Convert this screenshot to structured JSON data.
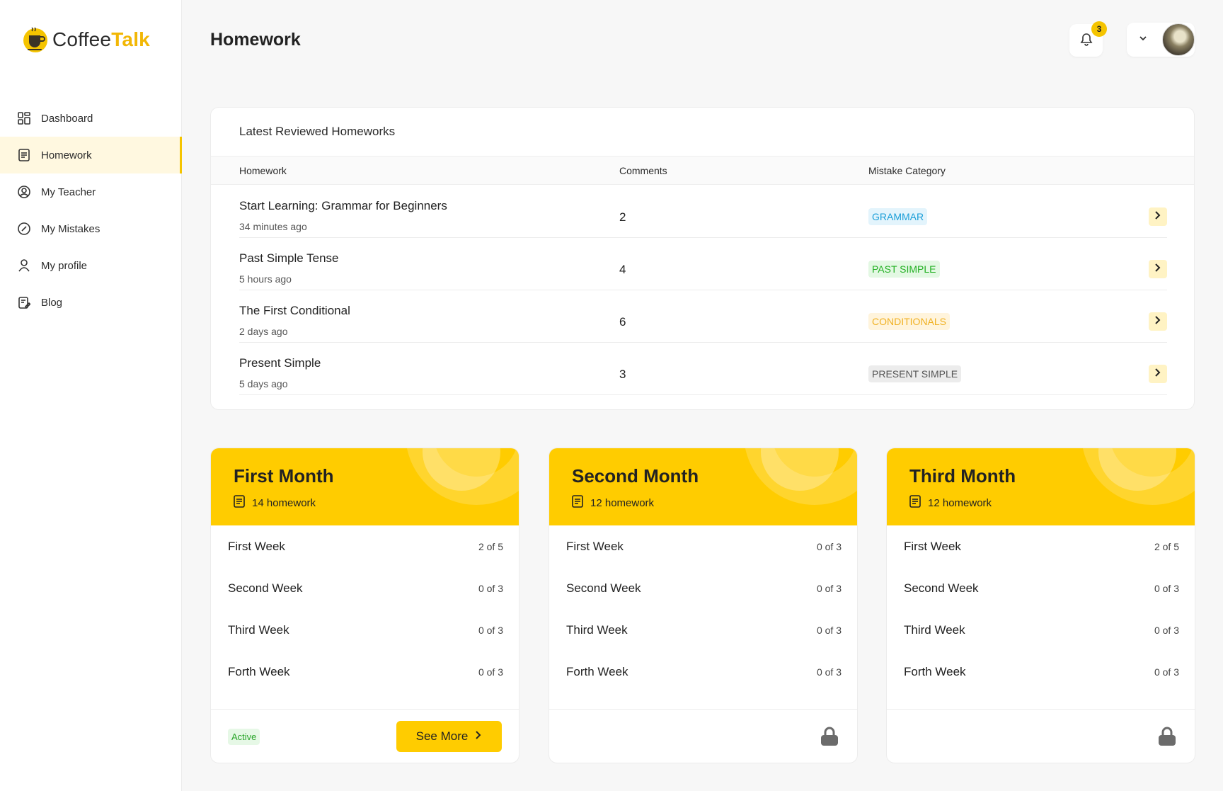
{
  "app": {
    "logo_first": "Coffee",
    "logo_second": "Talk"
  },
  "sidebar": {
    "items": [
      {
        "label": "Dashboard",
        "icon": "dashboard-icon"
      },
      {
        "label": "Homework",
        "icon": "homework-icon",
        "active": true
      },
      {
        "label": "My Teacher",
        "icon": "teacher-icon"
      },
      {
        "label": "My Mistakes",
        "icon": "mistakes-icon"
      },
      {
        "label": "My profile",
        "icon": "profile-icon"
      },
      {
        "label": "Blog",
        "icon": "blog-icon"
      }
    ]
  },
  "header": {
    "title": "Homework",
    "notification_count": "3"
  },
  "reviewed": {
    "title": "Latest Reviewed Homeworks",
    "columns": {
      "homework": "Homework",
      "comments": "Comments",
      "category": "Mistake Category"
    },
    "rows": [
      {
        "title": "Start Learning: Grammar for Beginners",
        "time": "34 minutes ago",
        "comments": "2",
        "category": "GRAMMAR",
        "tag_color": "#1a9ed8",
        "tag_bg": "#e3f4fc"
      },
      {
        "title": "Past Simple Tense",
        "time": "5 hours ago",
        "comments": "4",
        "category": "PAST SIMPLE",
        "tag_color": "#23b023",
        "tag_bg": "#e3f8e3"
      },
      {
        "title": "The First Conditional",
        "time": "2 days ago",
        "comments": "6",
        "category": "CONDITIONALS",
        "tag_color": "#f0b020",
        "tag_bg": "#fff4dc"
      },
      {
        "title": "Present Simple",
        "time": "5 days ago",
        "comments": "3",
        "category": "PRESENT SIMPLE",
        "tag_color": "#555555",
        "tag_bg": "#ececec"
      }
    ]
  },
  "months": [
    {
      "title": "First Month",
      "count": "14 homework",
      "weeks": [
        {
          "name": "First Week",
          "progress": "2 of 5"
        },
        {
          "name": "Second Week",
          "progress": "0 of 3"
        },
        {
          "name": "Third Week",
          "progress": "0 of 3"
        },
        {
          "name": "Forth Week",
          "progress": "0 of 3"
        }
      ],
      "status": "Active",
      "button": "See More",
      "locked": false
    },
    {
      "title": "Second Month",
      "count": "12 homework",
      "weeks": [
        {
          "name": "First Week",
          "progress": "0 of 3"
        },
        {
          "name": "Second Week",
          "progress": "0 of 3"
        },
        {
          "name": "Third Week",
          "progress": "0 of 3"
        },
        {
          "name": "Forth Week",
          "progress": "0 of 3"
        }
      ],
      "locked": true
    },
    {
      "title": "Third Month",
      "count": "12 homework",
      "weeks": [
        {
          "name": "First Week",
          "progress": "2 of 5"
        },
        {
          "name": "Second Week",
          "progress": "0 of 3"
        },
        {
          "name": "Third Week",
          "progress": "0 of 3"
        },
        {
          "name": "Forth Week",
          "progress": "0 of 3"
        }
      ],
      "locked": true
    }
  ],
  "colors": {
    "accent": "#ffcc00",
    "active_nav_bg": "#fff8e0"
  }
}
